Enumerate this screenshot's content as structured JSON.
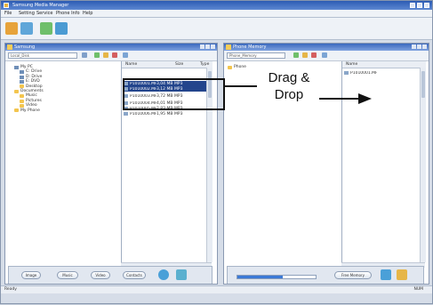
{
  "window": {
    "title": "Samsung Media Manager",
    "menu": [
      "File",
      "Setting",
      "Service",
      "Phone Info",
      "Help"
    ]
  },
  "left_pane": {
    "title": "Samsung",
    "path": "Local_Disk",
    "tree": [
      {
        "label": "My PC"
      },
      {
        "label": "C: Drive"
      },
      {
        "label": "D: Drive"
      },
      {
        "label": "E: DVD"
      },
      {
        "label": "Desktop"
      },
      {
        "label": "Documents"
      },
      {
        "label": "Music"
      },
      {
        "label": "Pictures"
      },
      {
        "label": "Video"
      },
      {
        "label": "My Phone"
      }
    ],
    "list_headers": [
      "Name",
      "Size",
      "Type"
    ],
    "files": [
      {
        "name": "P1010001.MP3",
        "size": "3,04 MB",
        "type": "MP3",
        "selected": true
      },
      {
        "name": "P1010002.MP3",
        "size": "3,12 MB",
        "type": "MP3",
        "selected": true
      },
      {
        "name": "P1010003.MP3",
        "size": "3,72 MB",
        "type": "MP3",
        "selected": false
      },
      {
        "name": "P1010004.MP3",
        "size": "4,01 MB",
        "type": "MP3",
        "selected": false
      },
      {
        "name": "P1010005.MP3",
        "size": "2,83 MB",
        "type": "MP3",
        "selected": false
      },
      {
        "name": "P1010006.MP3",
        "size": "1,95 MB",
        "type": "MP3",
        "selected": false
      }
    ],
    "footer_buttons": [
      "Image",
      "Music",
      "Video",
      "Contacts"
    ]
  },
  "right_pane": {
    "title": "Phone Memory",
    "path": "Phone_Memory",
    "tree": [
      {
        "label": "Phone"
      }
    ],
    "list_headers": [
      "Name"
    ],
    "files": [
      {
        "name": "P1010001.MP3"
      }
    ],
    "progress_fraction": 0.58,
    "footer_text": "Free Memory"
  },
  "annotation": {
    "line1": "Drag &",
    "line2": "Drop"
  },
  "status": {
    "left": "Ready",
    "right": "NUM"
  },
  "colors": {
    "titlebar": "#2c5bb3",
    "selection": "#23458c"
  }
}
